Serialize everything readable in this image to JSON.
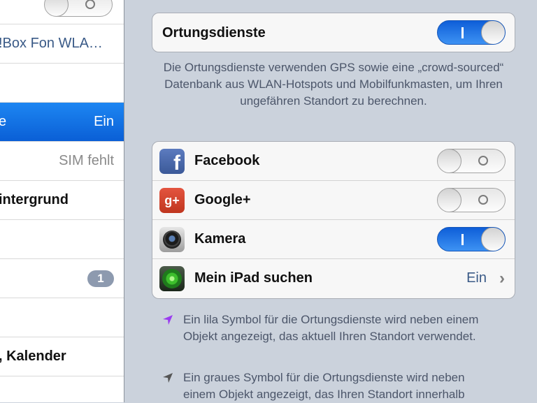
{
  "sidebar": {
    "row0": {
      "toggle_state": "off"
    },
    "row1": {
      "label": "!Box Fon WLA…"
    },
    "row3": {
      "label": "e",
      "value": "Ein"
    },
    "row4": {
      "value": "SIM fehlt"
    },
    "row5": {
      "label": "intergrund"
    },
    "row7": {
      "badge": "1"
    },
    "row9": {
      "label": ", Kalender"
    }
  },
  "location": {
    "title": "Ortungsdienste",
    "toggle_state": "on",
    "description": "Die Ortungsdienste verwenden GPS sowie eine „crowd-sourced“ Datenbank aus WLAN-Hotspots und Mobilfunkmasten, um Ihren ungefähren Standort zu berechnen."
  },
  "apps": [
    {
      "name": "Facebook",
      "icon": "facebook-icon",
      "toggle_state": "off"
    },
    {
      "name": "Google+",
      "icon": "google-plus-icon",
      "toggle_state": "off"
    },
    {
      "name": "Kamera",
      "icon": "camera-icon",
      "toggle_state": "on"
    },
    {
      "name": "Mein iPad suchen",
      "icon": "find-my-ipad-icon",
      "value": "Ein"
    }
  ],
  "notes": {
    "purple": "Ein lila Symbol für die Ortungsdienste wird neben einem Objekt angezeigt, das aktuell Ihren Standort verwendet.",
    "grey": "Ein graues Symbol für die Ortungsdienste wird neben einem Objekt angezeigt, das Ihren Standort innerhalb"
  },
  "colors": {
    "accent": "#0a5fd6",
    "purple": "#9b3cf0",
    "grey": "#555555"
  }
}
